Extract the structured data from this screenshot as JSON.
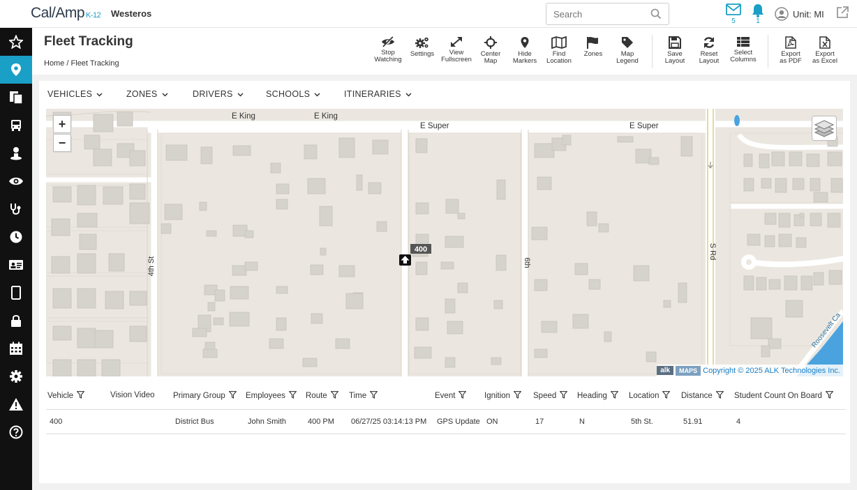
{
  "app": {
    "logo_text": "Cal/Amp",
    "logo_suffix": "K-12",
    "org_name": "Westeros"
  },
  "search": {
    "placeholder": "Search"
  },
  "top_icons": {
    "messages_count": "5",
    "alerts_count": "1"
  },
  "user": {
    "label": "Unit: MI"
  },
  "sidebar": {
    "items": [
      {
        "icon": "star-icon"
      },
      {
        "icon": "map-marker-icon",
        "active": true
      },
      {
        "icon": "copy-icon"
      },
      {
        "icon": "bus-icon"
      },
      {
        "icon": "driver-icon"
      },
      {
        "icon": "eye-icon"
      },
      {
        "icon": "stethoscope-icon"
      },
      {
        "icon": "clock-icon"
      },
      {
        "icon": "id-card-icon"
      },
      {
        "icon": "tablet-icon"
      },
      {
        "icon": "lock-icon"
      },
      {
        "icon": "calendar-icon"
      },
      {
        "icon": "gear-icon"
      },
      {
        "icon": "warning-icon"
      },
      {
        "icon": "help-icon"
      }
    ]
  },
  "page": {
    "title": "Fleet Tracking",
    "breadcrumb_home": "Home",
    "breadcrumb_sep": "/",
    "breadcrumb_current": "Fleet Tracking"
  },
  "toolbar": {
    "stop_watching": [
      "Stop",
      "Watching"
    ],
    "settings": [
      "Settings"
    ],
    "view_fullscreen": [
      "View",
      "Fullscreen"
    ],
    "center_map": [
      "Center",
      "Map"
    ],
    "hide_markers": [
      "Hide",
      "Markers"
    ],
    "find_location": [
      "Find",
      "Location"
    ],
    "zones": [
      "Zones"
    ],
    "map_legend": [
      "Map",
      "Legend"
    ],
    "save_layout": [
      "Save",
      "Layout"
    ],
    "reset_layout": [
      "Reset",
      "Layout"
    ],
    "select_columns": [
      "Select",
      "Columns"
    ],
    "export_pdf": [
      "Export",
      "as PDF"
    ],
    "export_excel": [
      "Export",
      "as Excel"
    ]
  },
  "nav_tabs": [
    "VEHICLES",
    "ZONES",
    "DRIVERS",
    "SCHOOLS",
    "ITINERARIES"
  ],
  "map": {
    "street_labels": {
      "e_king_1": "E King",
      "e_king_2": "E King",
      "e_super_1": "E Super",
      "e_super_2": "E Super",
      "fourth_st": "4th St",
      "sixth": "6th",
      "s_rd": "S Rd",
      "roosevelt": "Roosevelt Ca"
    },
    "vehicle_label": "400",
    "copyright_alk": "alk",
    "copyright_maps": "MAPS",
    "copyright_text": "Copyright © 2025 ALK Technologies Inc.",
    "zoom_in": "+",
    "zoom_out": "−"
  },
  "table": {
    "columns": [
      "Vehicle",
      "Vision Video",
      "Primary Group",
      "Employees",
      "Route",
      "Time",
      "Event",
      "Ignition",
      "Speed",
      "Heading",
      "Location",
      "Distance",
      "Student Count On Board"
    ],
    "filterable": [
      true,
      false,
      true,
      true,
      true,
      true,
      true,
      true,
      true,
      true,
      true,
      true,
      true
    ],
    "rows": [
      [
        "400",
        "",
        "District Bus",
        "John Smith",
        "400 PM",
        "06/27/25 03:14:13 PM",
        "GPS Update",
        "ON",
        "17",
        "N",
        "5th St.",
        "51.91",
        "4"
      ]
    ]
  },
  "colors": {
    "accent": "#1a9fc7",
    "sidebar_bg": "#111111",
    "map_bg": "#ebe7e0",
    "road": "#ffffff",
    "building": "#d6d3cd",
    "water": "#4aa3df"
  }
}
